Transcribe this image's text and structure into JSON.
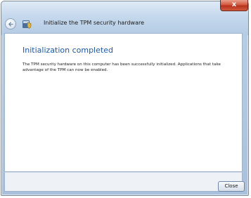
{
  "window": {
    "title": "Initialize the TPM security hardware",
    "close_glyph": "x"
  },
  "main": {
    "heading": "Initialization completed",
    "message": "The TPM security hardware on this computer has been successfully initialized. Applications that take advantage of the TPM can now be enabled."
  },
  "footer": {
    "close_label": "Close"
  },
  "icons": {
    "back": "back-arrow-icon",
    "shield": "tpm-shield-icon"
  },
  "colors": {
    "heading": "#1e5aa8",
    "close_button": "#c8432a",
    "frame": "#b6cde5"
  }
}
